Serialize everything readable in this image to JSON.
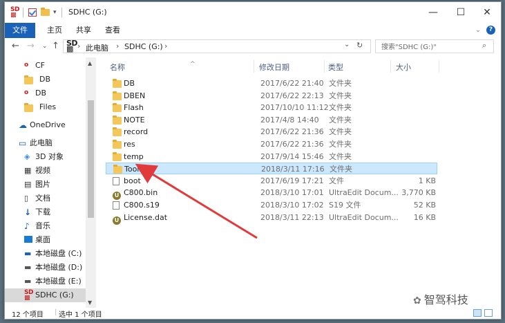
{
  "window": {
    "title": "SDHC (G:)",
    "controls": [
      "—",
      "☐",
      "✕"
    ]
  },
  "ribbon": {
    "tabs": [
      "文件",
      "主页",
      "共享",
      "查看"
    ]
  },
  "address": {
    "breadcrumb": [
      "此电脑",
      "SDHC (G:)"
    ],
    "search_placeholder": "搜索\"SDHC (G:)\""
  },
  "nav": {
    "items": [
      {
        "label": "CF",
        "icon": "sd-drive-icon"
      },
      {
        "label": "DB",
        "icon": "folder-icon"
      },
      {
        "label": "DB",
        "icon": "sd-drive-icon"
      },
      {
        "label": "Files",
        "icon": "folder-icon"
      },
      {
        "label": "OneDrive",
        "icon": "cloud-icon"
      },
      {
        "label": "此电脑",
        "icon": "computer-icon"
      },
      {
        "label": "3D 对象",
        "icon": "cube-icon"
      },
      {
        "label": "视频",
        "icon": "video-icon"
      },
      {
        "label": "图片",
        "icon": "picture-icon"
      },
      {
        "label": "文档",
        "icon": "document-icon"
      },
      {
        "label": "下载",
        "icon": "download-icon"
      },
      {
        "label": "音乐",
        "icon": "music-icon"
      },
      {
        "label": "桌面",
        "icon": "desktop-icon"
      },
      {
        "label": "本地磁盘 (C:)",
        "icon": "windows-drive-icon"
      },
      {
        "label": "本地磁盘 (D:)",
        "icon": "drive-icon"
      },
      {
        "label": "本地磁盘 (E:)",
        "icon": "drive-icon"
      },
      {
        "label": "SDHC (G:)",
        "icon": "sd-drive-icon"
      }
    ]
  },
  "columns": {
    "name": "名称",
    "date": "修改日期",
    "type": "类型",
    "size": "大小"
  },
  "files": [
    {
      "name": "DB",
      "date": "2017/6/22 21:40",
      "type": "文件夹",
      "size": "",
      "icon": "folder-icon"
    },
    {
      "name": "DBEN",
      "date": "2017/6/22 22:13",
      "type": "文件夹",
      "size": "",
      "icon": "folder-icon"
    },
    {
      "name": "Flash",
      "date": "2017/10/10 11:12",
      "type": "文件夹",
      "size": "",
      "icon": "folder-icon"
    },
    {
      "name": "NOTE",
      "date": "2017/4/8 14:40",
      "type": "文件夹",
      "size": "",
      "icon": "folder-icon"
    },
    {
      "name": "record",
      "date": "2017/6/22 21:36",
      "type": "文件夹",
      "size": "",
      "icon": "folder-icon"
    },
    {
      "name": "res",
      "date": "2017/6/22 21:36",
      "type": "文件夹",
      "size": "",
      "icon": "folder-icon"
    },
    {
      "name": "temp",
      "date": "2017/9/14 15:46",
      "type": "文件夹",
      "size": "",
      "icon": "folder-icon"
    },
    {
      "name": "Tools",
      "date": "2018/3/11 17:16",
      "type": "文件夹",
      "size": "",
      "icon": "folder-icon",
      "selected": true
    },
    {
      "name": "boot",
      "date": "2017/6/19 17:21",
      "type": "文件",
      "size": "1 KB",
      "icon": "file-icon"
    },
    {
      "name": "C800.bin",
      "date": "2018/3/10 17:01",
      "type": "UltraEdit Docum...",
      "size": "3,770 KB",
      "icon": "ultraedit-icon"
    },
    {
      "name": "C800.s19",
      "date": "2018/3/10 17:02",
      "type": "S19 文件",
      "size": "52 KB",
      "icon": "file-icon"
    },
    {
      "name": "License.dat",
      "date": "2018/3/11 22:13",
      "type": "UltraEdit Docum...",
      "size": "16 KB",
      "icon": "ultraedit-icon"
    }
  ],
  "status": {
    "count": "12 个项目",
    "selected": "选中 1 个项目"
  },
  "watermark": "智驾科技",
  "colors": {
    "file_tab": "#1a62b8",
    "selection": "#cce8ff",
    "arrow": "#e03a3a"
  }
}
